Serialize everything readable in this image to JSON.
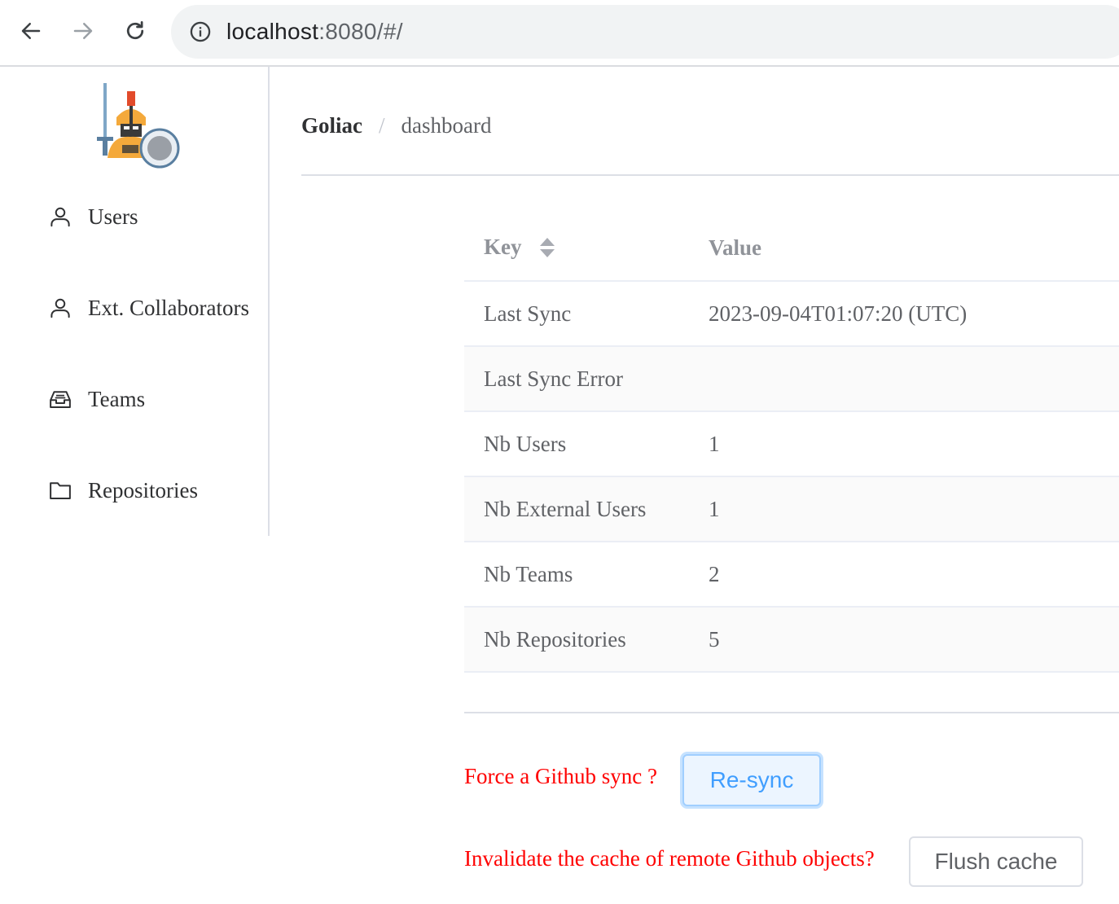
{
  "browser": {
    "url_host": "localhost",
    "url_rest": ":8080/#/",
    "icons": [
      "back-arrow-icon",
      "forward-arrow-icon",
      "reload-icon",
      "info-icon"
    ]
  },
  "sidebar": {
    "items": [
      {
        "label": "Users",
        "icon": "user-icon"
      },
      {
        "label": "Ext. Collaborators",
        "icon": "user-icon"
      },
      {
        "label": "Teams",
        "icon": "inbox-icon"
      },
      {
        "label": "Repositories",
        "icon": "folder-icon"
      }
    ]
  },
  "breadcrumb": {
    "root": "Goliac",
    "separator": "/",
    "current": "dashboard"
  },
  "table": {
    "headers": {
      "key": "Key",
      "value": "Value"
    },
    "rows": [
      {
        "key": "Last Sync",
        "value": "2023-09-04T01:07:20 (UTC)"
      },
      {
        "key": "Last Sync Error",
        "value": ""
      },
      {
        "key": "Nb Users",
        "value": "1"
      },
      {
        "key": "Nb External Users",
        "value": "1"
      },
      {
        "key": "Nb Teams",
        "value": "2"
      },
      {
        "key": "Nb Repositories",
        "value": "5"
      }
    ]
  },
  "actions": {
    "resync_prompt": "Force a Github sync ?",
    "resync_label": "Re-sync",
    "flush_prompt": "Invalidate the cache of remote Github objects?",
    "flush_label": "Flush cache"
  },
  "colors": {
    "accent": "#409eff",
    "prompt": "#ff0000"
  }
}
